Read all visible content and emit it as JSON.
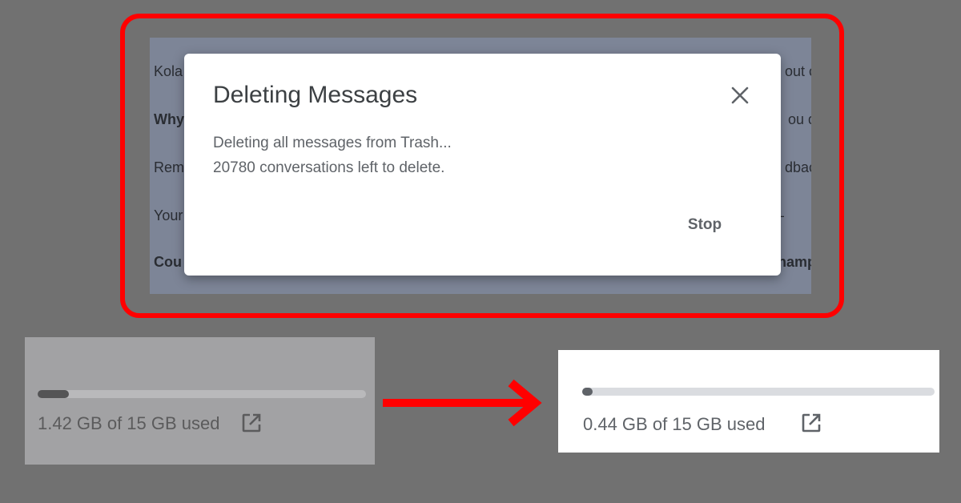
{
  "email_background": {
    "left_fragments": [
      "Kola",
      "Why",
      "Rem",
      "Your",
      "Cou"
    ],
    "right_fragments": [
      "out c",
      "ou d",
      "dbac",
      "–",
      "hamp"
    ]
  },
  "dialog": {
    "title": "Deleting Messages",
    "body_line_1": "Deleting all messages from Trash...",
    "body_line_2": "20780 conversations left to delete.",
    "stop_label": "Stop",
    "close_icon": "close-icon"
  },
  "storage_before": {
    "label": "1.42 GB of 15 GB used",
    "used_gb": 1.42,
    "total_gb": 15,
    "icon": "open-in-new-icon"
  },
  "storage_after": {
    "label": "0.44 GB of 15 GB used",
    "used_gb": 0.44,
    "total_gb": 15,
    "icon": "open-in-new-icon"
  },
  "colors": {
    "highlight": "#ff0000",
    "arrow": "#ff0000",
    "backdrop": "#717171"
  }
}
